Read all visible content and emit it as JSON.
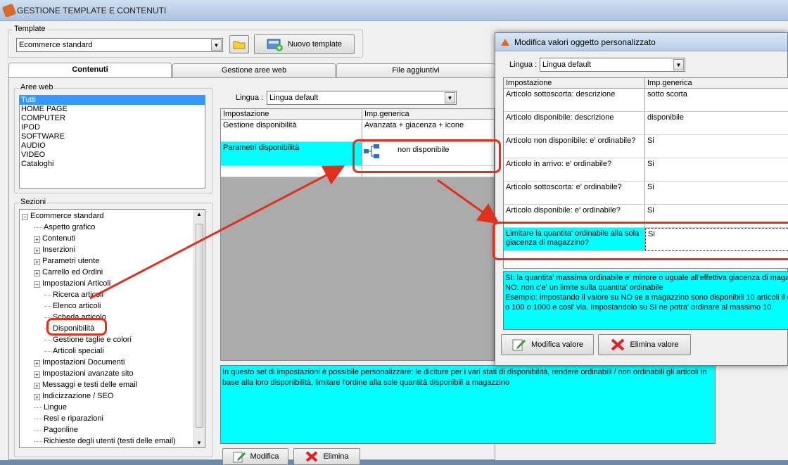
{
  "app": {
    "title": "GESTIONE TEMPLATE E CONTENUTI"
  },
  "template": {
    "group_label": "Template",
    "selected": "Ecommerce standard",
    "new_button": "Nuovo template"
  },
  "tabs": [
    {
      "label": "Contenuti",
      "active": true
    },
    {
      "label": "Gestione aree web",
      "active": false
    },
    {
      "label": "File aggiuntivi",
      "active": false
    }
  ],
  "aree_web": {
    "label": "Aree web",
    "items": [
      "Tutti",
      "HOME PAGE",
      "COMPUTER",
      "IPOD",
      "SOFTWARE",
      "AUDIO",
      "VIDEO",
      "Cataloghi"
    ],
    "selected_index": 0
  },
  "sezioni": {
    "label": "Sezioni",
    "root": "Ecommerce standard",
    "items": [
      {
        "label": "Aspetto grafico",
        "level": 1,
        "expandable": false
      },
      {
        "label": "Contenuti",
        "level": 1,
        "expandable": true
      },
      {
        "label": "Inserzioni",
        "level": 1,
        "expandable": true
      },
      {
        "label": "Parametri utente",
        "level": 1,
        "expandable": true
      },
      {
        "label": "Carrello ed Ordini",
        "level": 1,
        "expandable": true
      },
      {
        "label": "Impostazioni Articoli",
        "level": 1,
        "expandable": true,
        "expanded": true
      },
      {
        "label": "Ricerca articoli",
        "level": 2,
        "expandable": false
      },
      {
        "label": "Elenco articoli",
        "level": 2,
        "expandable": false
      },
      {
        "label": "Scheda articolo",
        "level": 2,
        "expandable": false
      },
      {
        "label": "Disponibilità",
        "level": 2,
        "expandable": false
      },
      {
        "label": "Gestione taglie e colori",
        "level": 2,
        "expandable": false
      },
      {
        "label": "Articoli speciali",
        "level": 2,
        "expandable": false
      },
      {
        "label": "Impostazioni Documenti",
        "level": 1,
        "expandable": true
      },
      {
        "label": "Impostazioni avanzate sito",
        "level": 1,
        "expandable": true
      },
      {
        "label": "Messaggi e testi delle email",
        "level": 1,
        "expandable": true
      },
      {
        "label": "Indicizzazione / SEO",
        "level": 1,
        "expandable": true
      },
      {
        "label": "Lingue",
        "level": 1,
        "expandable": false
      },
      {
        "label": "Resi e riparazioni",
        "level": 1,
        "expandable": false
      },
      {
        "label": "Pagonline",
        "level": 1,
        "expandable": false
      },
      {
        "label": "Richieste degli utenti (testi delle email)",
        "level": 1,
        "expandable": false
      }
    ]
  },
  "main": {
    "lingua_label": "Lingua :",
    "lingua_value": "Lingua default",
    "col1": "Impostazione",
    "col2": "Imp.generica",
    "rows": [
      {
        "name": "Gestione disponibilità",
        "value": "Avanzata + giacenza + icone"
      },
      {
        "name": "Parametri disponibilità",
        "value": "non disponibile"
      }
    ],
    "description": "In questo set di impostazioni è possibile personalizzare: le diciture per i vari stati di disponibilità, rendere ordinabili / non ordinabili gli articoli in base alla loro disponibilità, limitare l'ordine alla sole quantità disponibili a magazzino",
    "modify_button": "Modifica",
    "delete_button": "Elimina"
  },
  "dialog": {
    "title": "Modifica valori oggetto personalizzato",
    "lingua_label": "Lingua :",
    "lingua_value": "Lingua default",
    "col1": "Impostazione",
    "col2": "Imp.generica",
    "rows": [
      {
        "name": "Articolo sottoscorta: descrizione",
        "value": "sotto scorta"
      },
      {
        "name": "Articolo disponibile: descrizione",
        "value": "disponibile"
      },
      {
        "name": "Articolo non disponibile: e' ordinabile?",
        "value": "Si"
      },
      {
        "name": "Articolo in arrivo: e' ordinabile?",
        "value": "Si"
      },
      {
        "name": "Articolo sottoscorta: e' ordinabile?",
        "value": "Si"
      },
      {
        "name": "Articolo disponibile: e' ordinabile?",
        "value": "Si"
      },
      {
        "name": "Limitare la quantita' ordinabile alla sola giacenza di magazzino?",
        "value": "Si"
      }
    ],
    "description": [
      "SI: la quantita' massima ordinabile e' minore o uguale all'effettiva giacenza di magazz",
      "NO: non c'e' un limite sulla quantita' ordinabile",
      "Esempio: impostando il valore su NO se a magazzino sono disponibili 10 articoli il clie",
      "o 100 o 1000 e cosi' via. Impostandolo su SI ne potra' ordinare al massimo 10."
    ],
    "modify_button": "Modifica valore",
    "delete_button": "Elimina valore"
  },
  "colors": {
    "highlight": "#00ffff",
    "annotation": "#e0301e",
    "selection": "#3399ff"
  }
}
